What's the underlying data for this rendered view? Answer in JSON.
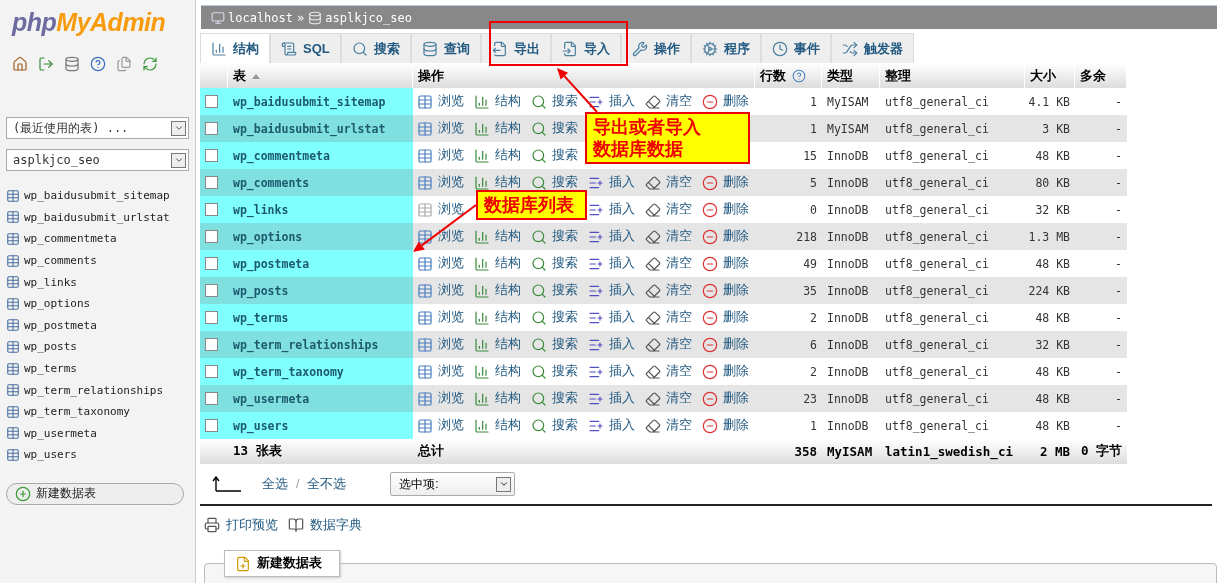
{
  "sidebar": {
    "logo_php": "php",
    "logo_myadmin": "MyAdmin",
    "recent_tables": "(最近使用的表) ...",
    "database": "asplkjco_seo",
    "tables": [
      {
        "name": "wp_baidusubmit_sitemap"
      },
      {
        "name": "wp_baidusubmit_urlstat"
      },
      {
        "name": "wp_commentmeta"
      },
      {
        "name": "wp_comments"
      },
      {
        "name": "wp_links"
      },
      {
        "name": "wp_options"
      },
      {
        "name": "wp_postmeta"
      },
      {
        "name": "wp_posts"
      },
      {
        "name": "wp_terms"
      },
      {
        "name": "wp_term_relationships"
      },
      {
        "name": "wp_term_taxonomy"
      },
      {
        "name": "wp_usermeta"
      },
      {
        "name": "wp_users"
      }
    ],
    "new_table": "新建数据表"
  },
  "breadcrumb": {
    "server": "localhost",
    "separator": "»",
    "database": "asplkjco_seo"
  },
  "tabs": [
    {
      "kind": "structure",
      "label": "结构",
      "selected": true
    },
    {
      "kind": "sql",
      "label": "SQL",
      "selected": false
    },
    {
      "kind": "search",
      "label": "搜索",
      "selected": false
    },
    {
      "kind": "query",
      "label": "查询",
      "selected": false
    },
    {
      "kind": "export",
      "label": "导出",
      "selected": false
    },
    {
      "kind": "import",
      "label": "导入",
      "selected": false
    },
    {
      "kind": "operations",
      "label": "操作",
      "selected": false
    },
    {
      "kind": "routines",
      "label": "程序",
      "selected": false
    },
    {
      "kind": "events",
      "label": "事件",
      "selected": false
    },
    {
      "kind": "triggers",
      "label": "触发器",
      "selected": false
    }
  ],
  "table": {
    "columns": [
      "表",
      "操作",
      "行数",
      "类型",
      "整理",
      "大小",
      "多余"
    ],
    "rows": [
      {
        "checked": false,
        "name": "wp_baidusubmit_sitemap",
        "empty": false,
        "actions": [
          {
            "kind": "browse",
            "label": "浏览"
          },
          {
            "kind": "structure",
            "label": "结构"
          },
          {
            "kind": "search",
            "label": "搜索"
          },
          {
            "kind": "insert",
            "label": "插入"
          },
          {
            "kind": "empty",
            "label": "清空"
          },
          {
            "kind": "drop",
            "label": "删除"
          }
        ],
        "rows": "1",
        "type": "MyISAM",
        "collation": "utf8_general_ci",
        "size": "4.1 KB",
        "overhead": "-"
      },
      {
        "checked": false,
        "name": "wp_baidusubmit_urlstat",
        "empty": false,
        "actions": [
          {
            "kind": "browse",
            "label": "浏览"
          },
          {
            "kind": "structure",
            "label": "结构"
          },
          {
            "kind": "search",
            "label": "搜索"
          }
        ],
        "rows": "1",
        "type": "MyISAM",
        "collation": "utf8_general_ci",
        "size": "3 KB",
        "overhead": "-"
      },
      {
        "checked": false,
        "name": "wp_commentmeta",
        "empty": false,
        "actions": [
          {
            "kind": "browse",
            "label": "浏览"
          },
          {
            "kind": "structure",
            "label": "结构"
          },
          {
            "kind": "search",
            "label": "搜索"
          }
        ],
        "rows": "15",
        "type": "InnoDB",
        "collation": "utf8_general_ci",
        "size": "48 KB",
        "overhead": "-"
      },
      {
        "checked": false,
        "name": "wp_comments",
        "empty": false,
        "actions": [
          {
            "kind": "browse",
            "label": "浏览"
          },
          {
            "kind": "structure",
            "label": "结构"
          },
          {
            "kind": "search",
            "label": "搜索"
          },
          {
            "kind": "insert",
            "label": "插入"
          },
          {
            "kind": "empty",
            "label": "清空"
          },
          {
            "kind": "drop",
            "label": "删除"
          }
        ],
        "rows": "5",
        "type": "InnoDB",
        "collation": "utf8_general_ci",
        "size": "80 KB",
        "overhead": "-"
      },
      {
        "checked": false,
        "name": "wp_links",
        "empty": true,
        "actions": [
          {
            "kind": "browse",
            "label": "浏览"
          },
          {
            "kind": "insert",
            "label": "插入"
          },
          {
            "kind": "empty",
            "label": "清空"
          },
          {
            "kind": "drop",
            "label": "删除"
          }
        ],
        "rows": "0",
        "type": "InnoDB",
        "collation": "utf8_general_ci",
        "size": "32 KB",
        "overhead": "-"
      },
      {
        "checked": false,
        "name": "wp_options",
        "empty": false,
        "actions": [
          {
            "kind": "browse",
            "label": "浏览"
          },
          {
            "kind": "structure",
            "label": "结构"
          },
          {
            "kind": "search",
            "label": "搜索"
          },
          {
            "kind": "insert",
            "label": "插入"
          },
          {
            "kind": "empty",
            "label": "清空"
          },
          {
            "kind": "drop",
            "label": "删除"
          }
        ],
        "rows": "218",
        "type": "InnoDB",
        "collation": "utf8_general_ci",
        "size": "1.3 MB",
        "overhead": "-"
      },
      {
        "checked": false,
        "name": "wp_postmeta",
        "empty": false,
        "actions": [
          {
            "kind": "browse",
            "label": "浏览"
          },
          {
            "kind": "structure",
            "label": "结构"
          },
          {
            "kind": "search",
            "label": "搜索"
          },
          {
            "kind": "insert",
            "label": "插入"
          },
          {
            "kind": "empty",
            "label": "清空"
          },
          {
            "kind": "drop",
            "label": "删除"
          }
        ],
        "rows": "49",
        "type": "InnoDB",
        "collation": "utf8_general_ci",
        "size": "48 KB",
        "overhead": "-"
      },
      {
        "checked": false,
        "name": "wp_posts",
        "empty": false,
        "actions": [
          {
            "kind": "browse",
            "label": "浏览"
          },
          {
            "kind": "structure",
            "label": "结构"
          },
          {
            "kind": "search",
            "label": "搜索"
          },
          {
            "kind": "insert",
            "label": "插入"
          },
          {
            "kind": "empty",
            "label": "清空"
          },
          {
            "kind": "drop",
            "label": "删除"
          }
        ],
        "rows": "35",
        "type": "InnoDB",
        "collation": "utf8_general_ci",
        "size": "224 KB",
        "overhead": "-"
      },
      {
        "checked": false,
        "name": "wp_terms",
        "empty": false,
        "actions": [
          {
            "kind": "browse",
            "label": "浏览"
          },
          {
            "kind": "structure",
            "label": "结构"
          },
          {
            "kind": "search",
            "label": "搜索"
          },
          {
            "kind": "insert",
            "label": "插入"
          },
          {
            "kind": "empty",
            "label": "清空"
          },
          {
            "kind": "drop",
            "label": "删除"
          }
        ],
        "rows": "2",
        "type": "InnoDB",
        "collation": "utf8_general_ci",
        "size": "48 KB",
        "overhead": "-"
      },
      {
        "checked": false,
        "name": "wp_term_relationships",
        "empty": false,
        "actions": [
          {
            "kind": "browse",
            "label": "浏览"
          },
          {
            "kind": "structure",
            "label": "结构"
          },
          {
            "kind": "search",
            "label": "搜索"
          },
          {
            "kind": "insert",
            "label": "插入"
          },
          {
            "kind": "empty",
            "label": "清空"
          },
          {
            "kind": "drop",
            "label": "删除"
          }
        ],
        "rows": "6",
        "type": "InnoDB",
        "collation": "utf8_general_ci",
        "size": "32 KB",
        "overhead": "-"
      },
      {
        "checked": false,
        "name": "wp_term_taxonomy",
        "empty": false,
        "actions": [
          {
            "kind": "browse",
            "label": "浏览"
          },
          {
            "kind": "structure",
            "label": "结构"
          },
          {
            "kind": "search",
            "label": "搜索"
          },
          {
            "kind": "insert",
            "label": "插入"
          },
          {
            "kind": "empty",
            "label": "清空"
          },
          {
            "kind": "drop",
            "label": "删除"
          }
        ],
        "rows": "2",
        "type": "InnoDB",
        "collation": "utf8_general_ci",
        "size": "48 KB",
        "overhead": "-"
      },
      {
        "checked": false,
        "name": "wp_usermeta",
        "empty": false,
        "actions": [
          {
            "kind": "browse",
            "label": "浏览"
          },
          {
            "kind": "structure",
            "label": "结构"
          },
          {
            "kind": "search",
            "label": "搜索"
          },
          {
            "kind": "insert",
            "label": "插入"
          },
          {
            "kind": "empty",
            "label": "清空"
          },
          {
            "kind": "drop",
            "label": "删除"
          }
        ],
        "rows": "23",
        "type": "InnoDB",
        "collation": "utf8_general_ci",
        "size": "48 KB",
        "overhead": "-"
      },
      {
        "checked": false,
        "name": "wp_users",
        "empty": false,
        "actions": [
          {
            "kind": "browse",
            "label": "浏览"
          },
          {
            "kind": "structure",
            "label": "结构"
          },
          {
            "kind": "search",
            "label": "搜索"
          },
          {
            "kind": "insert",
            "label": "插入"
          },
          {
            "kind": "empty",
            "label": "清空"
          },
          {
            "kind": "drop",
            "label": "删除"
          }
        ],
        "rows": "1",
        "type": "InnoDB",
        "collation": "utf8_general_ci",
        "size": "48 KB",
        "overhead": "-"
      }
    ],
    "footer": {
      "count": "13 张表",
      "label": "总计",
      "rows": "358",
      "type": "MyISAM",
      "collation": "latin1_swedish_ci",
      "size": "2 MB",
      "overhead": "0 字节"
    }
  },
  "bulk": {
    "check_all": "全选",
    "divider": "/",
    "uncheck_all": "全不选",
    "with_selected": "选中项:"
  },
  "links": [
    {
      "kind": "print",
      "label": "打印预览"
    },
    {
      "kind": "dictionary",
      "label": "数据字典"
    }
  ],
  "create_table": "新建数据表",
  "annotations": [
    {
      "kind": "frame"
    },
    {
      "kind": "callout",
      "lines": [
        "导出或者导入",
        "数据库数据"
      ]
    },
    {
      "kind": "callout",
      "lines": [
        "数据库列表"
      ]
    }
  ]
}
